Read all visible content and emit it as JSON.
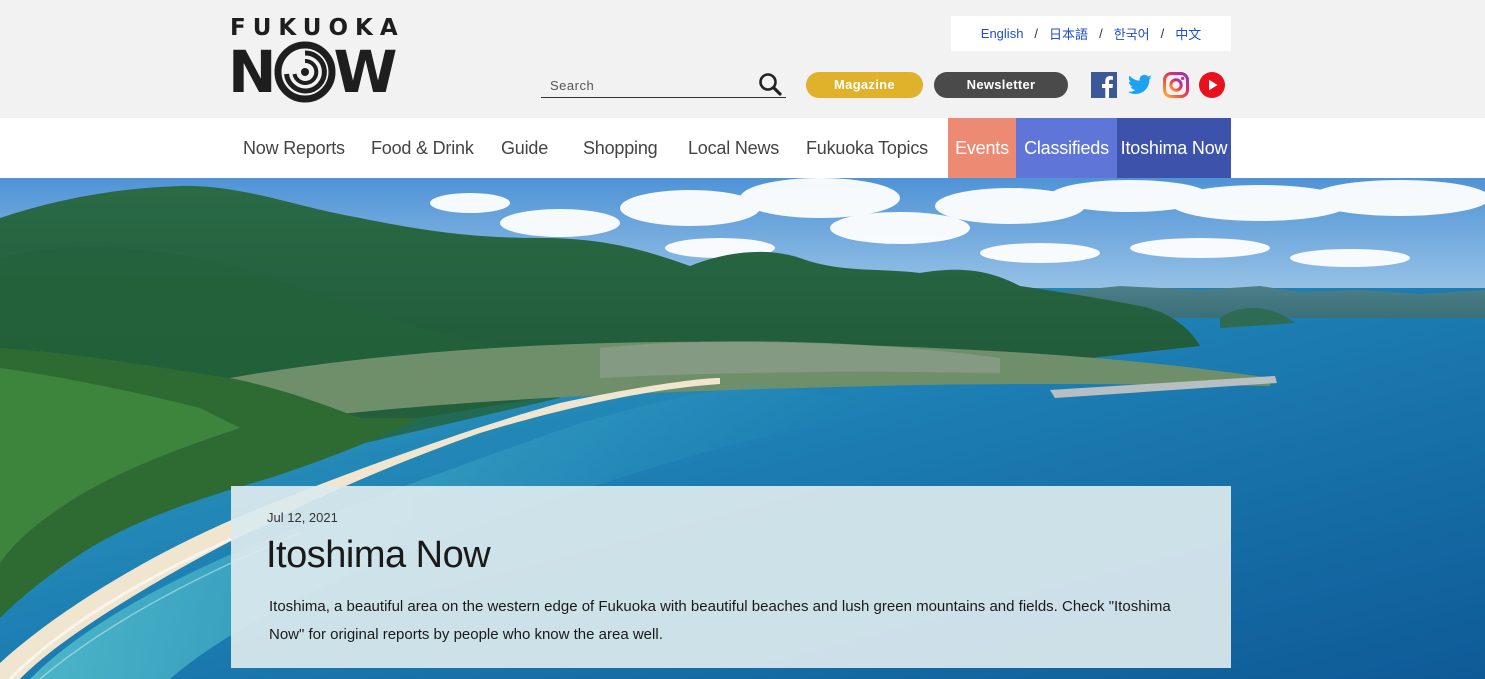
{
  "header": {
    "logo_top": "FUKUOKA",
    "logo_bottom_left": "N",
    "logo_bottom_right": "W",
    "languages": [
      "English",
      "日本語",
      "한국어",
      "中文"
    ],
    "language_separator": "/",
    "search_placeholder": "Search",
    "magazine_label": "Magazine",
    "newsletter_label": "Newsletter",
    "social_icons": [
      "facebook-icon",
      "twitter-icon",
      "instagram-icon",
      "youtube-icon"
    ],
    "colors": {
      "magazine": "#e0b12b",
      "newsletter": "#4a4a4a"
    }
  },
  "nav": {
    "items": [
      "Now Reports",
      "Food & Drink",
      "Guide",
      "Shopping",
      "Local News",
      "Fukuoka Topics"
    ],
    "events": "Events",
    "classifieds": "Classifieds",
    "itoshima": "Itoshima Now",
    "colors": {
      "events": "#ec8a73",
      "classifieds": "#5f76d8",
      "itoshima": "#3d52ab"
    }
  },
  "hero": {
    "date": "Jul 12, 2021",
    "title": "Itoshima Now",
    "description": "Itoshima, a beautiful area on the western edge of Fukuoka with beautiful beaches and lush green mountains and fields. Check \"Itoshima Now\" for original reports by people who know the area well."
  }
}
